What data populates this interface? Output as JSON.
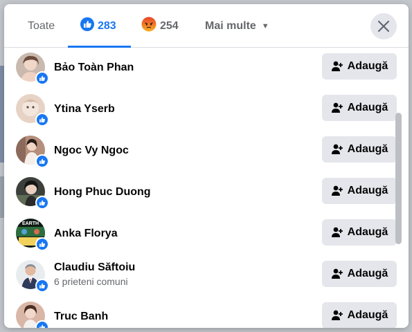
{
  "tabs": {
    "all_label": "Toate",
    "like_count": "283",
    "angry_count": "254",
    "more_label": "Mai multe"
  },
  "people": [
    {
      "name": "Bảo Toàn Phan",
      "subtext": "",
      "action": "Adaugă",
      "avatar_color": "#c9b9ae"
    },
    {
      "name": "Ytina Yserb",
      "subtext": "",
      "action": "Adaugă",
      "avatar_color": "#e7d3c5"
    },
    {
      "name": "Ngoc Vy Ngoc",
      "subtext": "",
      "action": "Adaugă",
      "avatar_color": "#b58f7c"
    },
    {
      "name": "Hong Phuc Duong",
      "subtext": "",
      "action": "Adaugă",
      "avatar_color": "#3c3f3a"
    },
    {
      "name": "Anka Florya",
      "subtext": "",
      "action": "Adaugă",
      "avatar_color": "#1e3d2c"
    },
    {
      "name": "Claudiu Săftoiu",
      "subtext": "6 prieteni comuni",
      "action": "Adaugă",
      "avatar_color": "#cfd4da"
    },
    {
      "name": "Truc Banh",
      "subtext": "",
      "action": "Adaugă",
      "avatar_color": "#d9b6a6"
    }
  ],
  "avatar_texts": {
    "earth": "EARTH"
  },
  "colors": {
    "accent": "#1877f2",
    "button_bg": "#e4e6eb",
    "text": "#050505",
    "secondary": "#65676b"
  }
}
